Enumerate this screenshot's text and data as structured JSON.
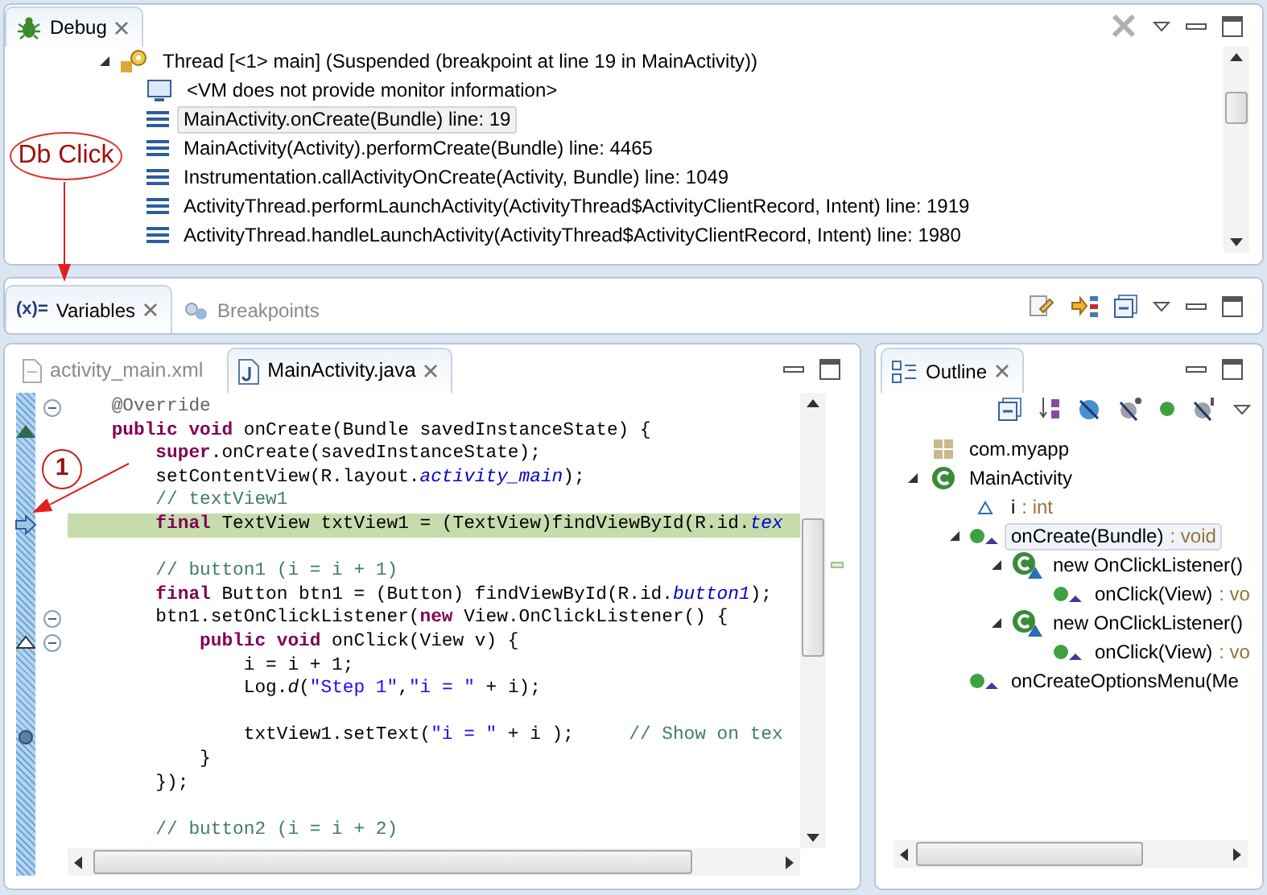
{
  "debug": {
    "tab": {
      "label": "Debug",
      "selected": true
    },
    "thread": {
      "label": "Thread [<1> main] (Suspended (breakpoint at line 19 in MainActivity))",
      "expanded": true,
      "children": [
        {
          "kind": "monitor",
          "label": "<VM does not provide monitor information>",
          "selected": false
        },
        {
          "kind": "frame",
          "label": "MainActivity.onCreate(Bundle) line: 19",
          "selected": true
        },
        {
          "kind": "frame",
          "label": "MainActivity(Activity).performCreate(Bundle) line: 4465",
          "selected": false
        },
        {
          "kind": "frame",
          "label": "Instrumentation.callActivityOnCreate(Activity, Bundle) line: 1049",
          "selected": false
        },
        {
          "kind": "frame",
          "label": "ActivityThread.performLaunchActivity(ActivityThread$ActivityClientRecord, Intent) line: 1919",
          "selected": false
        },
        {
          "kind": "frame",
          "label": "ActivityThread.handleLaunchActivity(ActivityThread$ActivityClientRecord, Intent) line: 1980",
          "selected": false
        }
      ]
    }
  },
  "variables_panel": {
    "tabs": [
      {
        "kind": "variables",
        "icon": "(x)=",
        "label": "Variables",
        "selected": true
      },
      {
        "kind": "breakpoints",
        "label": "Breakpoints",
        "selected": false
      }
    ]
  },
  "editor": {
    "tabs": [
      {
        "kind": "xml",
        "label": "activity_main.xml",
        "selected": false
      },
      {
        "kind": "java",
        "label": "MainActivity.java",
        "selected": true
      }
    ],
    "lines": [
      {
        "kind": "code",
        "fold": true,
        "tokens": [
          {
            "kind": "annotation",
            "text": "    @Override"
          }
        ]
      },
      {
        "kind": "code",
        "marker": {
          "kind": "override"
        },
        "tokens": [
          {
            "kind": "kw",
            "text": "    public void"
          },
          {
            "kind": "plain",
            "text": " onCreate(Bundle savedInstanceState) {"
          }
        ]
      },
      {
        "kind": "code",
        "tokens": [
          {
            "kind": "kw",
            "text": "        super"
          },
          {
            "kind": "plain",
            "text": ".onCreate(savedInstanceState);"
          }
        ]
      },
      {
        "kind": "code",
        "tokens": [
          {
            "kind": "plain",
            "text": "        setContentView(R.layout."
          },
          {
            "kind": "field",
            "text": "activity_main"
          },
          {
            "kind": "plain",
            "text": ");"
          }
        ]
      },
      {
        "kind": "code",
        "tokens": [
          {
            "kind": "comment",
            "text": "        // textView1"
          }
        ]
      },
      {
        "kind": "code",
        "marker": {
          "kind": "instruction-pointer"
        },
        "current": true,
        "tokens": [
          {
            "kind": "kw",
            "text": "        final"
          },
          {
            "kind": "plain",
            "text": " TextView txtView1 = (TextView)findViewById(R.id."
          },
          {
            "kind": "field",
            "text": "tex"
          }
        ]
      },
      {
        "kind": "blank"
      },
      {
        "kind": "code",
        "tokens": [
          {
            "kind": "comment",
            "text": "        // button1 (i = i + 1)"
          }
        ]
      },
      {
        "kind": "code",
        "tokens": [
          {
            "kind": "kw",
            "text": "        final"
          },
          {
            "kind": "plain",
            "text": " Button btn1 = (Button) findViewById(R.id."
          },
          {
            "kind": "field",
            "text": "button1"
          },
          {
            "kind": "plain",
            "text": ");"
          }
        ]
      },
      {
        "kind": "code",
        "fold": true,
        "tokens": [
          {
            "kind": "plain",
            "text": "        btn1.setOnClickListener("
          },
          {
            "kind": "kw",
            "text": "new"
          },
          {
            "kind": "plain",
            "text": " View.OnClickListener() {"
          }
        ]
      },
      {
        "kind": "code",
        "fold": true,
        "marker": {
          "kind": "implements"
        },
        "tokens": [
          {
            "kind": "kw",
            "text": "            public void"
          },
          {
            "kind": "plain",
            "text": " onClick(View v) {"
          }
        ]
      },
      {
        "kind": "code",
        "tokens": [
          {
            "kind": "plain",
            "text": "                i = i + 1;"
          }
        ]
      },
      {
        "kind": "code",
        "tokens": [
          {
            "kind": "plain",
            "text": "                Log."
          },
          {
            "kind": "static",
            "text": "d"
          },
          {
            "kind": "plain",
            "text": "("
          },
          {
            "kind": "string",
            "text": "\"Step 1\""
          },
          {
            "kind": "plain",
            "text": ","
          },
          {
            "kind": "string",
            "text": "\"i = \""
          },
          {
            "kind": "plain",
            "text": " + i);"
          }
        ]
      },
      {
        "kind": "blank"
      },
      {
        "kind": "code",
        "marker": {
          "kind": "breakpoint"
        },
        "tokens": [
          {
            "kind": "plain",
            "text": "                txtView1.setText("
          },
          {
            "kind": "string",
            "text": "\"i = \""
          },
          {
            "kind": "plain",
            "text": " + i );     "
          },
          {
            "kind": "comment",
            "text": "// Show on tex"
          }
        ]
      },
      {
        "kind": "code",
        "tokens": [
          {
            "kind": "plain",
            "text": "            }"
          }
        ]
      },
      {
        "kind": "code",
        "tokens": [
          {
            "kind": "plain",
            "text": "        });"
          }
        ]
      },
      {
        "kind": "blank"
      },
      {
        "kind": "code",
        "tokens": [
          {
            "kind": "comment",
            "text": "        // button2 (i = i + 2)"
          }
        ]
      }
    ]
  },
  "outline": {
    "tab": {
      "label": "Outline",
      "selected": true
    },
    "tree": [
      {
        "kind": "package",
        "name": "com.myapp",
        "selected": false
      },
      {
        "kind": "class",
        "name": "MainActivity",
        "selected": false,
        "expanded": true,
        "children": [
          {
            "kind": "field",
            "name": "i",
            "type": ": int",
            "selected": false
          },
          {
            "kind": "method",
            "name": "onCreate(Bundle)",
            "type": ": void",
            "selected": true,
            "expanded": true,
            "children": [
              {
                "kind": "anonymous",
                "name": "new OnClickListener()",
                "selected": false,
                "expanded": true,
                "children": [
                  {
                    "kind": "method",
                    "name": "onClick(View)",
                    "type": ": vo",
                    "selected": false
                  }
                ]
              },
              {
                "kind": "anonymous",
                "name": "new OnClickListener()",
                "selected": false,
                "expanded": true,
                "children": [
                  {
                    "kind": "method",
                    "name": "onClick(View)",
                    "type": ": vo",
                    "selected": false
                  }
                ]
              }
            ]
          },
          {
            "kind": "method",
            "name": "onCreateOptionsMenu(Me",
            "selected": false
          }
        ]
      }
    ]
  },
  "annotations": [
    {
      "kind": "ellipse",
      "label": "Db Click"
    },
    {
      "kind": "circle",
      "label": "1"
    }
  ]
}
